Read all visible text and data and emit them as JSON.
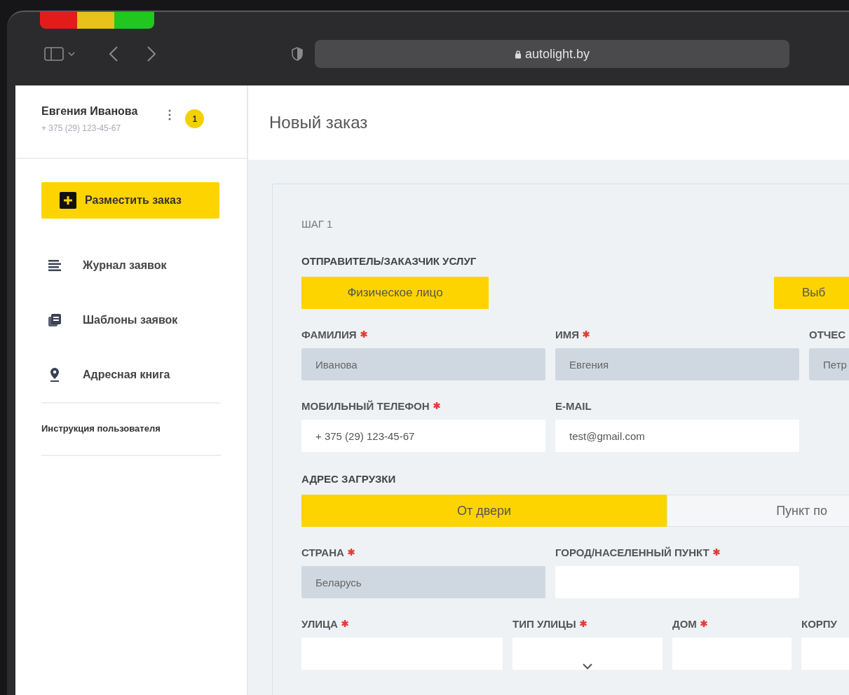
{
  "browser": {
    "address": "autolight.by"
  },
  "user": {
    "name": "Евгения Иванова",
    "phone": "+ 375 (29) 123-45-67",
    "notifications": "1"
  },
  "sidebar": {
    "primary_button": "Разместить заказ",
    "items": [
      {
        "label": "Журнал заявок",
        "kind": "list"
      },
      {
        "label": "Шаблоны заявок",
        "kind": "templates"
      },
      {
        "label": "Адресная книга",
        "kind": "pin"
      }
    ],
    "help_link": "Инструкция пользователя"
  },
  "page": {
    "title": "Новый заказ"
  },
  "form": {
    "step": "ШАГ 1",
    "sender": {
      "heading": "ОТПРАВИТЕЛЬ/ЗАКАЗЧИК УСЛУГ",
      "buttons": [
        "Физическое лицо",
        "Выб"
      ]
    },
    "name_row": [
      {
        "label": "ФАМИЛИЯ",
        "required": true,
        "value": "Иванова",
        "disabled": true
      },
      {
        "label": "ИМЯ",
        "required": true,
        "value": "Евгения",
        "disabled": true
      },
      {
        "label": "ОТЧЕС",
        "value": "Петр",
        "disabled": true
      }
    ],
    "contact_row": [
      {
        "label": "МОБИЛЬНЫЙ ТЕЛЕФОН",
        "required": true,
        "value": "+ 375 (29) 123-45-67",
        "disabled": false
      },
      {
        "label": "E-MAIL",
        "value": "test@gmail.com",
        "disabled": false
      }
    ],
    "address": {
      "heading": "АДРЕС ЗАГРУЗКИ",
      "tabs": [
        {
          "label": "От двери",
          "selected": true
        },
        {
          "label": "Пункт по",
          "selected": false
        }
      ]
    },
    "location_row": [
      {
        "label": "СТРАНА",
        "required": true,
        "value": "Беларусь",
        "disabled": true
      },
      {
        "label": "ГОРОД/НАСЕЛЕННЫЙ ПУНКТ",
        "required": true,
        "disabled": false
      }
    ],
    "street_row": [
      {
        "label": "УЛИЦА",
        "required": true,
        "kind": "text"
      },
      {
        "label": "ТИП УЛИЦЫ",
        "required": true,
        "kind": "select"
      },
      {
        "label": "ДОМ",
        "required": true,
        "kind": "text"
      },
      {
        "label": "КОРПУ",
        "kind": "text"
      }
    ]
  }
}
